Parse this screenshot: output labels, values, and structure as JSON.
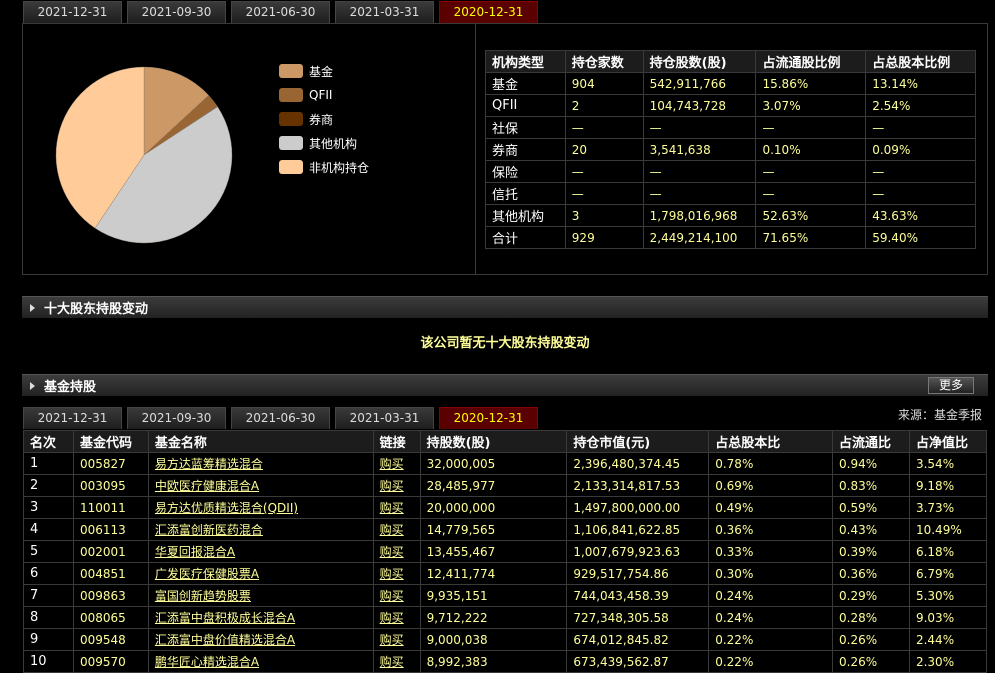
{
  "top_tabs": [
    "2021-12-31",
    "2021-09-30",
    "2021-06-30",
    "2021-03-31",
    "2020-12-31"
  ],
  "active_tab": 4,
  "chart_data": {
    "type": "pie",
    "legend_placement": "right",
    "slices": [
      {
        "label": "基金",
        "value": 13.14,
        "color": "#cc9966"
      },
      {
        "label": "QFII",
        "value": 2.54,
        "color": "#996633"
      },
      {
        "label": "券商",
        "value": 0.09,
        "color": "#663300"
      },
      {
        "label": "其他机构",
        "value": 43.63,
        "color": "#cccccc"
      },
      {
        "label": "非机构持仓",
        "value": 40.6,
        "color": "#ffcc99"
      }
    ]
  },
  "inst_table": {
    "headers": [
      "机构类型",
      "持仓家数",
      "持仓股数(股)",
      "占流通股比例",
      "占总股本比例"
    ],
    "rows": [
      [
        "基金",
        "904",
        "542,911,766",
        "15.86%",
        "13.14%"
      ],
      [
        "QFII",
        "2",
        "104,743,728",
        "3.07%",
        "2.54%"
      ],
      [
        "社保",
        "—",
        "—",
        "—",
        "—"
      ],
      [
        "券商",
        "20",
        "3,541,638",
        "0.10%",
        "0.09%"
      ],
      [
        "保险",
        "—",
        "—",
        "—",
        "—"
      ],
      [
        "信托",
        "—",
        "—",
        "—",
        "—"
      ],
      [
        "其他机构",
        "3",
        "1,798,016,968",
        "52.63%",
        "43.63%"
      ],
      [
        "合计",
        "929",
        "2,449,214,100",
        "71.65%",
        "59.40%"
      ]
    ]
  },
  "section1": {
    "title": "十大股东持股变动",
    "message": "该公司暂无十大股东持股变动"
  },
  "section2": {
    "title": "基金持股",
    "more": "更多",
    "source": "来源：基金季报"
  },
  "fund_tabs": [
    "2021-12-31",
    "2021-09-30",
    "2021-06-30",
    "2021-03-31",
    "2020-12-31"
  ],
  "fund_table": {
    "headers": [
      "名次",
      "基金代码",
      "基金名称",
      "链接",
      "持股数(股)",
      "持仓市值(元)",
      "占总股本比",
      "占流通比",
      "占净值比"
    ],
    "rows": [
      [
        "1",
        "005827",
        "易方达蓝筹精选混合",
        "购买",
        "32,000,005",
        "2,396,480,374.45",
        "0.78%",
        "0.94%",
        "3.54%"
      ],
      [
        "2",
        "003095",
        "中欧医疗健康混合A",
        "购买",
        "28,485,977",
        "2,133,314,817.53",
        "0.69%",
        "0.83%",
        "9.18%"
      ],
      [
        "3",
        "110011",
        "易方达优质精选混合(QDII)",
        "购买",
        "20,000,000",
        "1,497,800,000.00",
        "0.49%",
        "0.59%",
        "3.73%"
      ],
      [
        "4",
        "006113",
        "汇添富创新医药混合",
        "购买",
        "14,779,565",
        "1,106,841,622.85",
        "0.36%",
        "0.43%",
        "10.49%"
      ],
      [
        "5",
        "002001",
        "华夏回报混合A",
        "购买",
        "13,455,467",
        "1,007,679,923.63",
        "0.33%",
        "0.39%",
        "6.18%"
      ],
      [
        "6",
        "004851",
        "广发医疗保健股票A",
        "购买",
        "12,411,774",
        "929,517,754.86",
        "0.30%",
        "0.36%",
        "6.79%"
      ],
      [
        "7",
        "009863",
        "富国创新趋势股票",
        "购买",
        "9,935,151",
        "744,043,458.39",
        "0.24%",
        "0.29%",
        "5.30%"
      ],
      [
        "8",
        "008065",
        "汇添富中盘积极成长混合A",
        "购买",
        "9,712,222",
        "727,348,305.58",
        "0.24%",
        "0.28%",
        "9.03%"
      ],
      [
        "9",
        "009548",
        "汇添富中盘价值精选混合A",
        "购买",
        "9,000,038",
        "674,012,845.82",
        "0.22%",
        "0.26%",
        "2.44%"
      ],
      [
        "10",
        "009570",
        "鹏华匠心精选混合A",
        "购买",
        "8,992,383",
        "673,439,562.87",
        "0.22%",
        "0.26%",
        "2.30%"
      ]
    ]
  }
}
